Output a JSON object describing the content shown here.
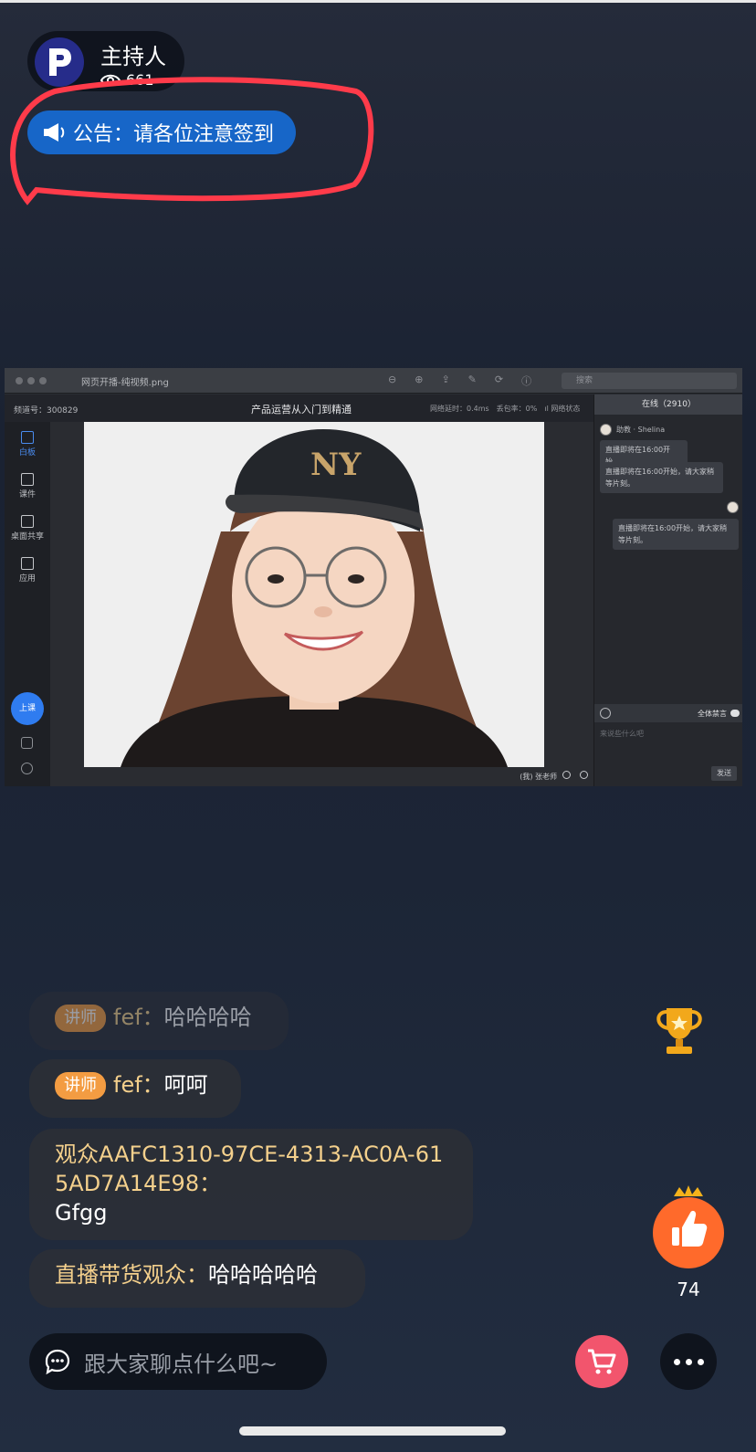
{
  "host": {
    "name": "主持人",
    "views": "661"
  },
  "notice": {
    "text": "公告：请各位注意签到"
  },
  "share": {
    "file_name": "网页开播-纯视频.png",
    "search_placeholder": "搜索",
    "channel": "频道号：300829",
    "course_title": "产品运营从入门到精通",
    "stats": "网络延时：0.4ms　丢包率：0%　ıl 网络状态",
    "sidebar": [
      "白板",
      "课件",
      "桌面共享",
      "应用"
    ],
    "class_button": "上课",
    "teacher": "(我) 张老师",
    "chat": {
      "online": "在线（2910）",
      "assistant": "助教 · Shelina",
      "messages": [
        "直播即将在16:00开始。",
        "直播即将在16:00开始，请大家稍等片刻。",
        "直播即将在16:00开始，请大家稍等片刻。"
      ],
      "mute_all": "全体禁言",
      "input_placeholder": "来说些什么吧",
      "send": "发送"
    }
  },
  "live_chat": [
    {
      "tag": "讲师",
      "user": "fef：",
      "text": "哈哈哈哈"
    },
    {
      "tag": "讲师",
      "user": "fef：",
      "text": "呵呵"
    },
    {
      "user": "观众AAFC1310-97CE-4313-AC0A-615AD7A14E98：",
      "text": "Gfgg"
    },
    {
      "user": "直播带货观众：",
      "text": "哈哈哈哈哈"
    }
  ],
  "likes": "74",
  "chat_input": {
    "placeholder": "跟大家聊点什么吧~"
  },
  "icons": {
    "host_avatar": "brand-p-logo-icon",
    "views": "eye-icon",
    "notice": "megaphone-icon",
    "trophy": "trophy-icon",
    "like": "thumbs-up-icon",
    "chat": "chat-bubble-icon",
    "cart": "shopping-cart-icon",
    "more": "more-dots-icon"
  },
  "colors": {
    "notice_bg": "#1766c8",
    "tag_bg": "#f39c42",
    "username": "#f4d08c",
    "like_bg": "#ff6a2b",
    "cart_bg": "#f2556d",
    "annotation": "#ff3b4a"
  }
}
